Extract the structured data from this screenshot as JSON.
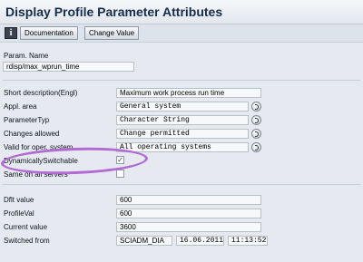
{
  "window": {
    "title": "Display Profile Parameter Attributes"
  },
  "toolbar": {
    "info_icon": "i",
    "documentation_label": "Documentation",
    "change_value_label": "Change Value"
  },
  "param": {
    "label": "Param. Name",
    "value": "rdisp/max_wprun_time"
  },
  "attributes": [
    {
      "label": "Short description(Engl)",
      "value": "Maximum work process run time"
    },
    {
      "label": "Appl. area",
      "value": "General system"
    },
    {
      "label": "ParameterTyp",
      "value": "Character String"
    },
    {
      "label": "Changes allowed",
      "value": "Change permitted"
    },
    {
      "label": "Valid for oper. system",
      "value": "All operating systems"
    }
  ],
  "flags": {
    "dynamic_label": "DynamicallySwitchable",
    "dynamic_checked": "✓",
    "same_label": "Same on all servers"
  },
  "values": {
    "dflt_label": "Dflt value",
    "dflt_value": "600",
    "profile_label": "ProfileVal",
    "profile_value": "600",
    "current_label": "Current value",
    "current_value": "3600",
    "switched_label": "Switched from",
    "switched_user": "SCIADM_DIA",
    "switched_date": "16.06.2011",
    "switched_time": "11:13:52"
  },
  "colors": {
    "title": "#152c4a",
    "highlight_ellipse": "#b16bd3",
    "background": "#e6eaf0"
  }
}
